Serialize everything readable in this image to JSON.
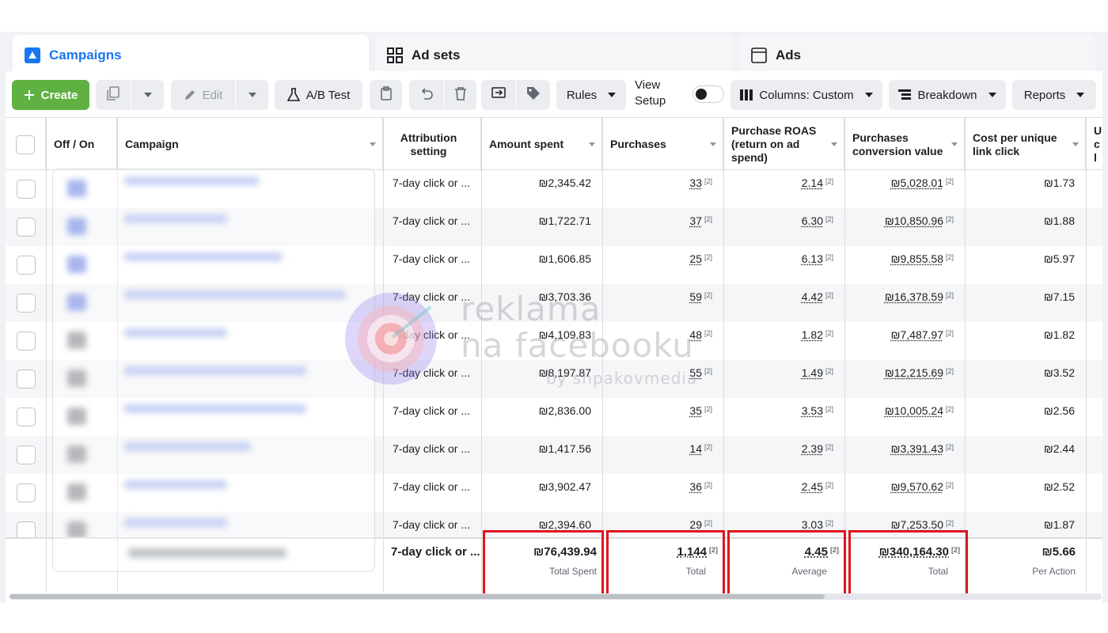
{
  "tabs": [
    {
      "label": "Campaigns",
      "icon": "flag-icon",
      "active": true
    },
    {
      "label": "Ad sets",
      "icon": "grid-icon",
      "active": false
    },
    {
      "label": "Ads",
      "icon": "window-icon",
      "active": false
    }
  ],
  "toolbar": {
    "create": "Create",
    "edit": "Edit",
    "ab_test": "A/B Test",
    "rules": "Rules",
    "view_setup": "View Setup",
    "columns": "Columns: Custom",
    "breakdown": "Breakdown",
    "reports": "Reports"
  },
  "columns": {
    "off_on": "Off / On",
    "campaign": "Campaign",
    "attribution": "Attribution setting",
    "amount_spent": "Amount spent",
    "purchases": "Purchases",
    "roas": "Purchase ROAS (return on ad spend)",
    "conv_value": "Purchases conversion value",
    "cost_per_click": "Cost per unique link click",
    "next_col": "U cl"
  },
  "rows": [
    {
      "attribution": "7-day click or ...",
      "amount": "₪2,345.42",
      "purchases": "33",
      "roas": "2.14",
      "conv_value": "₪5,028.01",
      "cpc": "₪1.73",
      "ref": "[2]"
    },
    {
      "attribution": "7-day click or ...",
      "amount": "₪1,722.71",
      "purchases": "37",
      "roas": "6.30",
      "conv_value": "₪10,850.96",
      "cpc": "₪1.88",
      "ref": "[2]"
    },
    {
      "attribution": "7-day click or ...",
      "amount": "₪1,606.85",
      "purchases": "25",
      "roas": "6.13",
      "conv_value": "₪9,855.58",
      "cpc": "₪5.97",
      "ref": "[2]"
    },
    {
      "attribution": "7-day click or ...",
      "amount": "₪3,703.36",
      "purchases": "59",
      "roas": "4.42",
      "conv_value": "₪16,378.59",
      "cpc": "₪7.15",
      "ref": "[2]"
    },
    {
      "attribution": "7-day click or ...",
      "amount": "₪4,109.83",
      "purchases": "48",
      "roas": "1.82",
      "conv_value": "₪7,487.97",
      "cpc": "₪1.82",
      "ref": "[2]"
    },
    {
      "attribution": "7-day click or ...",
      "amount": "₪8,197.87",
      "purchases": "55",
      "roas": "1.49",
      "conv_value": "₪12,215.69",
      "cpc": "₪3.52",
      "ref": "[2]"
    },
    {
      "attribution": "7-day click or ...",
      "amount": "₪2,836.00",
      "purchases": "35",
      "roas": "3.53",
      "conv_value": "₪10,005.24",
      "cpc": "₪2.56",
      "ref": "[2]"
    },
    {
      "attribution": "7-day click or ...",
      "amount": "₪1,417.56",
      "purchases": "14",
      "roas": "2.39",
      "conv_value": "₪3,391.43",
      "cpc": "₪2.44",
      "ref": "[2]"
    },
    {
      "attribution": "7-day click or ...",
      "amount": "₪3,902.47",
      "purchases": "36",
      "roas": "2.45",
      "conv_value": "₪9,570.62",
      "cpc": "₪2.52",
      "ref": "[2]"
    },
    {
      "attribution": "7-day click or ...",
      "amount": "₪2,394.60",
      "purchases": "29",
      "roas": "3.03",
      "conv_value": "₪7,253.50",
      "cpc": "₪1.87",
      "ref": "[2]"
    }
  ],
  "totals": {
    "attribution": "7-day click or ...",
    "amount": "₪76,439.94",
    "amount_label": "Total Spent",
    "purchases": "1,144",
    "purchases_label": "Total",
    "roas": "4.45",
    "roas_label": "Average",
    "conv_value": "₪340,164.30",
    "conv_value_label": "Total",
    "cpc": "₪5.66",
    "cpc_label": "Per Action",
    "ref": "[2]"
  },
  "watermark": {
    "line1": "reklama",
    "line2": "na facebooku",
    "line3": "by shpakovmedia"
  },
  "colors": {
    "accent": "#1877f2",
    "create_green": "#5fb142",
    "highlight_red": "#e0141e"
  }
}
